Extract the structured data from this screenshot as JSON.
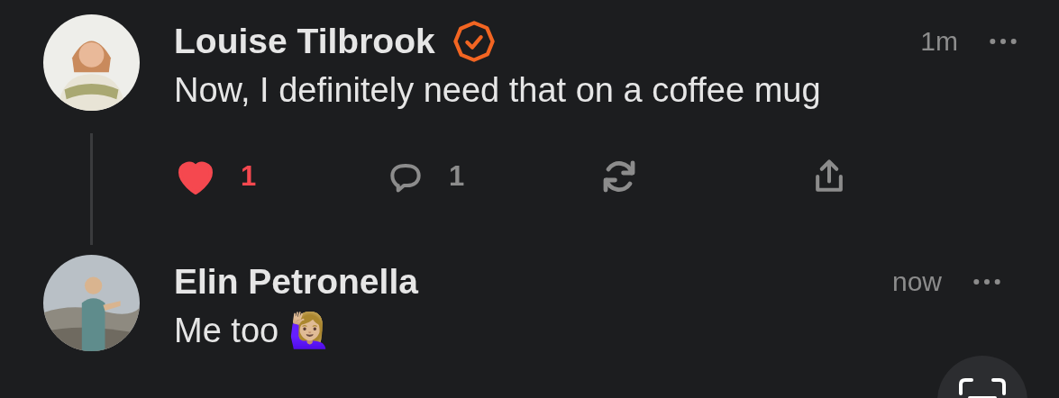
{
  "comments": [
    {
      "author": "Louise Tilbrook",
      "verified": true,
      "time": "1m",
      "text": "Now, I definitely need that on a coffee mug",
      "actions": {
        "liked": true,
        "likes": "1",
        "replies": "1"
      }
    },
    {
      "author": "Elin Petronella",
      "verified": false,
      "time": "now",
      "text": "Me too 🙋🏼‍♀️"
    }
  ]
}
